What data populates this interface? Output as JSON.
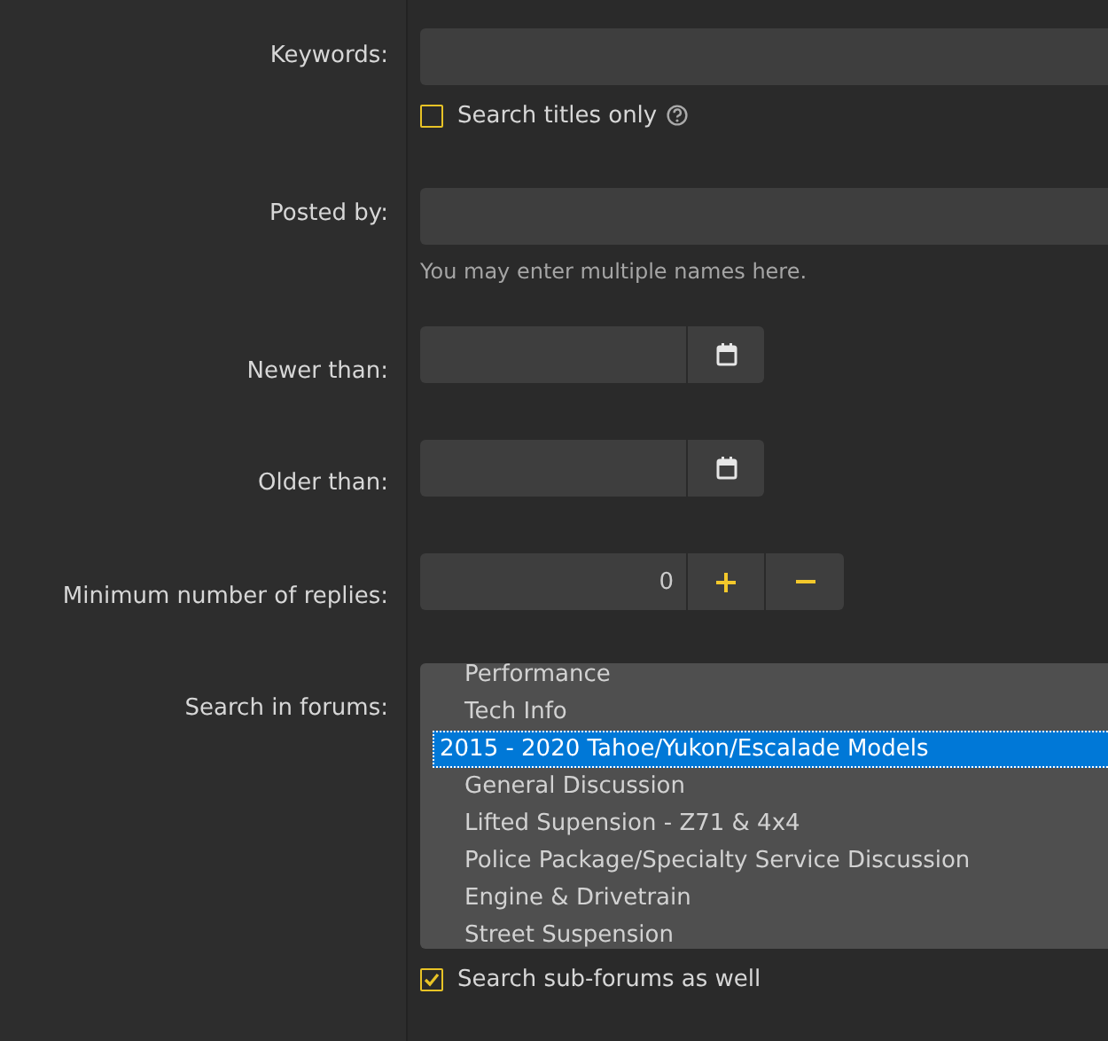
{
  "keywords": {
    "label": "Keywords:",
    "titles_only": {
      "label": "Search titles only",
      "checked": false
    }
  },
  "posted_by": {
    "label": "Posted by:",
    "hint": "You may enter multiple names here."
  },
  "newer_than": {
    "label": "Newer than:"
  },
  "older_than": {
    "label": "Older than:"
  },
  "min_replies": {
    "label": "Minimum number of replies:",
    "value": "0"
  },
  "forums": {
    "label": "Search in forums:",
    "continued": [
      {
        "label": "Performance",
        "selected": false
      },
      {
        "label": "Tech Info",
        "selected": false
      }
    ],
    "categories": [
      {
        "label": "2015 - 2020 Tahoe/Yukon/Escalade Models",
        "selected": true,
        "children": [
          {
            "label": "General Discussion",
            "selected": false
          },
          {
            "label": "Lifted Supension - Z71 & 4x4",
            "selected": false
          },
          {
            "label": "Police Package/Specialty Service Discussion",
            "selected": false
          },
          {
            "label": "Engine & Drivetrain",
            "selected": false
          },
          {
            "label": "Street Suspension",
            "selected": false
          }
        ]
      }
    ]
  },
  "sub_forums": {
    "label": "Search sub-forums as well",
    "checked": true
  }
}
